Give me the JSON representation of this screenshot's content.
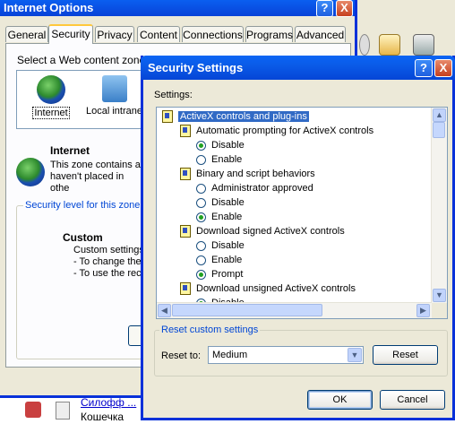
{
  "internet_options": {
    "title": "Internet Options",
    "tabs": [
      "General",
      "Security",
      "Privacy",
      "Content",
      "Connections",
      "Programs",
      "Advanced"
    ],
    "active_tab": "Security",
    "zone_prompt": "Select a Web content zone to",
    "zones": [
      {
        "label": "Internet",
        "icon": "globe-icon",
        "selected": true
      },
      {
        "label": "Local intrane",
        "icon": "local-intranet-icon",
        "selected": false
      }
    ],
    "zone_info_title": "Internet",
    "zone_info_lines": [
      "This zone contains all",
      "haven't placed in othe"
    ],
    "security_level_legend": "Security level for this zone",
    "custom_title": "Custom",
    "custom_lines": [
      "Custom settings",
      "- To change the",
      "- To use the rec"
    ]
  },
  "background": {
    "bottom_link": "Силофф ...",
    "bottom_text": "Кошечка"
  },
  "security_settings": {
    "title": "Security Settings",
    "settings_label": "Settings:",
    "tree": [
      {
        "type": "category",
        "label": "ActiveX controls and plug-ins",
        "highlighted": true
      },
      {
        "type": "setting",
        "label": "Automatic prompting for ActiveX controls"
      },
      {
        "type": "option",
        "label": "Disable",
        "checked": true
      },
      {
        "type": "option",
        "label": "Enable",
        "checked": false
      },
      {
        "type": "setting",
        "label": "Binary and script behaviors"
      },
      {
        "type": "option",
        "label": "Administrator approved",
        "checked": false
      },
      {
        "type": "option",
        "label": "Disable",
        "checked": false
      },
      {
        "type": "option",
        "label": "Enable",
        "checked": true
      },
      {
        "type": "setting",
        "label": "Download signed ActiveX controls"
      },
      {
        "type": "option",
        "label": "Disable",
        "checked": false
      },
      {
        "type": "option",
        "label": "Enable",
        "checked": false
      },
      {
        "type": "option",
        "label": "Prompt",
        "checked": true
      },
      {
        "type": "setting",
        "label": "Download unsigned ActiveX controls"
      },
      {
        "type": "option",
        "label": "Disable",
        "checked": true
      }
    ],
    "reset_legend": "Reset custom settings",
    "reset_to_label": "Reset to:",
    "reset_to_value": "Medium",
    "reset_button": "Reset",
    "ok_button": "OK",
    "cancel_button": "Cancel",
    "help_glyph": "?",
    "close_glyph": "X"
  }
}
